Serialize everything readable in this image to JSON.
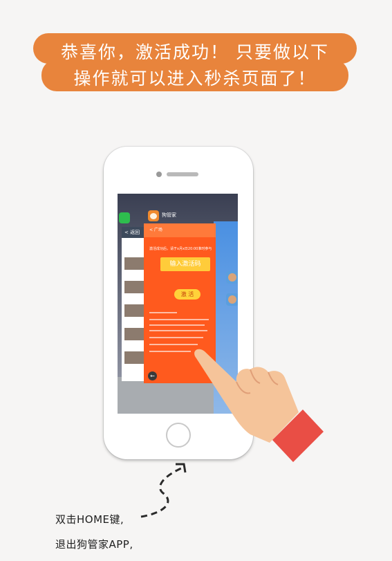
{
  "banner": {
    "line1": "恭喜你，激活成功！ 只要做以下",
    "line2": "操作就可以进入秒杀页面了！",
    "color": "#e8843c"
  },
  "phone_screen": {
    "back_card_header": "< 返回",
    "app_name": "狗管家",
    "orange_card": {
      "header": "< 广场",
      "intro_text": "激活成功后，请于x月x日20:00准时参与",
      "input_placeholder": "输入激活码",
      "activate_button": "激 活"
    }
  },
  "instructions": {
    "line1": "双击HOME键,",
    "line2": "退出狗管家APP,"
  }
}
